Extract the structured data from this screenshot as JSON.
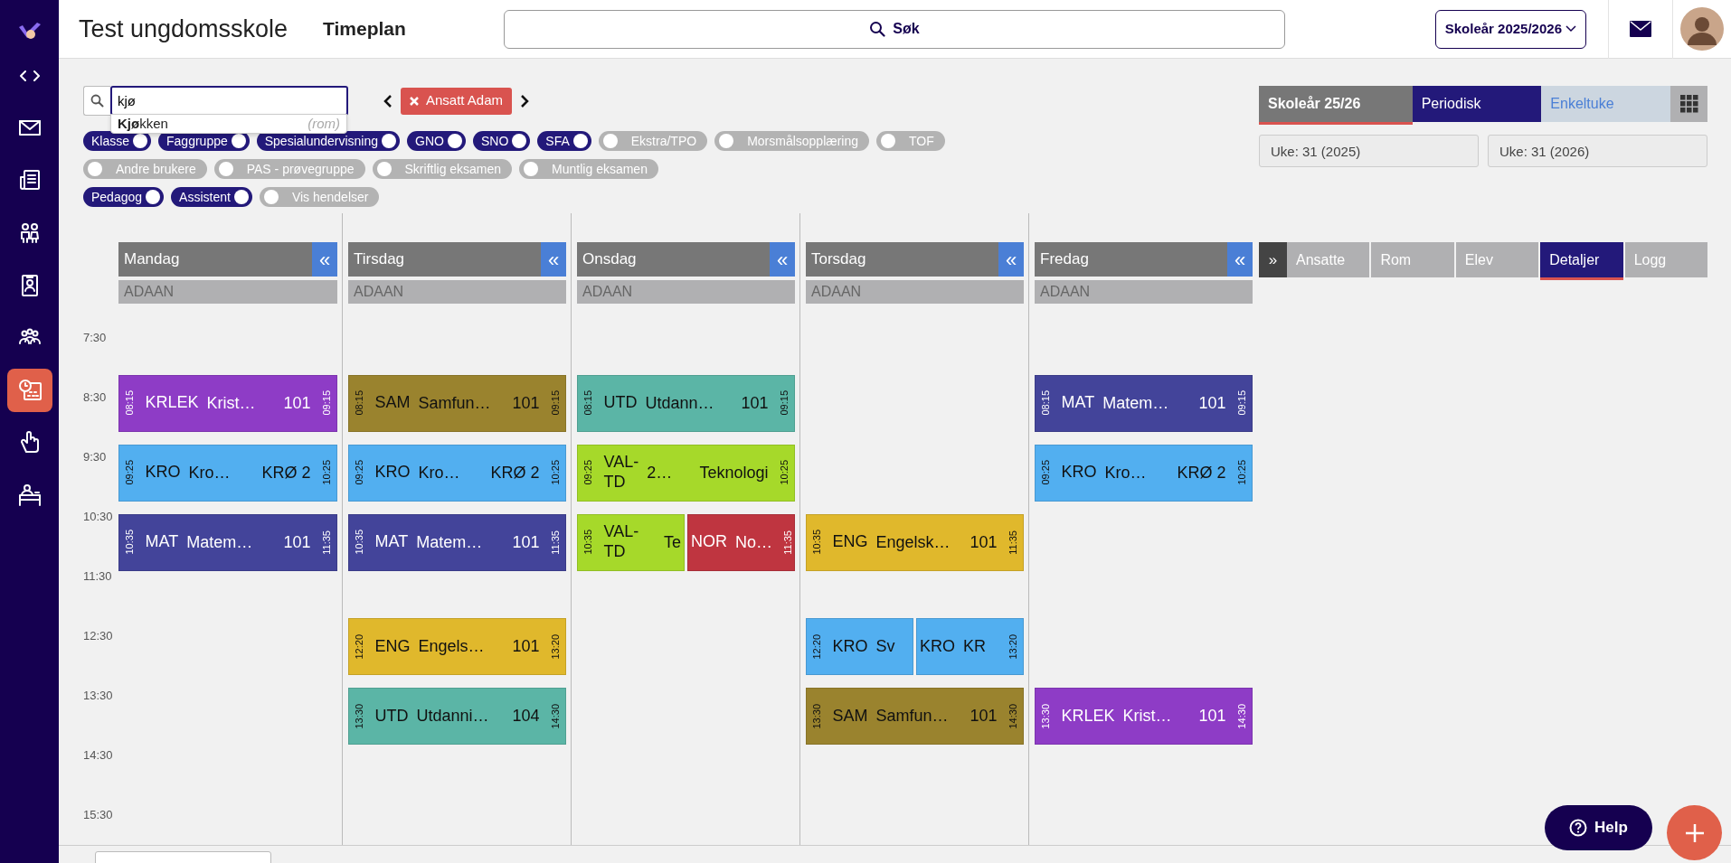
{
  "header": {
    "school": "Test ungdomsskole",
    "page": "Timeplan",
    "search": "Søk",
    "year_button": "Skoleår 2025/2026"
  },
  "sidebar": {
    "items": [
      {
        "selected": false
      },
      {
        "selected": false
      },
      {
        "selected": false
      },
      {
        "selected": false
      },
      {
        "selected": false
      },
      {
        "selected": false
      },
      {
        "selected": true
      },
      {
        "selected": false
      },
      {
        "selected": false
      }
    ]
  },
  "filter": {
    "search_value": "kjø",
    "suggestions": [
      {
        "text": "**Kjø**kken",
        "type": "(rom)"
      }
    ],
    "tag": "Ansatt Adam",
    "chip_rows": [
      [
        {
          "label": "Klasse",
          "on": true
        },
        {
          "label": "Faggruppe",
          "on": true
        },
        {
          "label": "Spesialundervisning",
          "on": true
        },
        {
          "label": "GNO",
          "on": true
        },
        {
          "label": "SNO",
          "on": true
        },
        {
          "label": "SFA",
          "on": true
        },
        {
          "label": "Ekstra/TPO",
          "on": false
        },
        {
          "label": "Morsmålsopplæring",
          "on": false
        },
        {
          "label": "TOF",
          "on": false
        }
      ],
      [
        {
          "label": "Andre brukere",
          "on": false
        },
        {
          "label": "PAS - prøvegruppe",
          "on": false
        },
        {
          "label": "Skriftlig eksamen",
          "on": false
        },
        {
          "label": "Muntlig eksamen",
          "on": false
        }
      ],
      [
        {
          "label": "Pedagog",
          "on": true
        },
        {
          "label": "Assistent",
          "on": true
        },
        {
          "label": "Vis hendelser",
          "on": false
        }
      ]
    ]
  },
  "schedule": {
    "times": [
      "7:30",
      "8:30",
      "9:30",
      "10:30",
      "11:30",
      "12:30",
      "13:30",
      "14:30",
      "15:30"
    ],
    "days": [
      {
        "name": "Mandag",
        "collapse": "«",
        "teacher": "ADAAN",
        "slots": [
          {
            "start": "08:15",
            "end": "09:15",
            "events": [
              {
                "code": "KRLEK",
                "name": "Krist…",
                "room": "101",
                "color": "#8e3cc6"
              }
            ]
          },
          {
            "start": "09:25",
            "end": "10:25",
            "events": [
              {
                "code": "KRO",
                "name": "Kro…",
                "room": "KRØ 2",
                "color": "#52aff0"
              }
            ]
          },
          {
            "start": "10:35",
            "end": "11:35",
            "events": [
              {
                "code": "MAT",
                "name": "Matem…",
                "room": "101",
                "color": "#43449a"
              }
            ]
          }
        ]
      },
      {
        "name": "Tirsdag",
        "collapse": "«",
        "teacher": "ADAAN",
        "slots": [
          {
            "start": "08:15",
            "end": "09:15",
            "events": [
              {
                "code": "SAM",
                "name": "Samfun…",
                "room": "101",
                "color": "#9a832e"
              }
            ]
          },
          {
            "start": "09:25",
            "end": "10:25",
            "events": [
              {
                "code": "KRO",
                "name": "Kro…",
                "room": "KRØ 2",
                "color": "#52aff0"
              }
            ]
          },
          {
            "start": "10:35",
            "end": "11:35",
            "events": [
              {
                "code": "MAT",
                "name": "Matem…",
                "room": "101",
                "color": "#43449a"
              }
            ]
          },
          {
            "start": "12:20",
            "end": "13:20",
            "events": [
              {
                "code": "ENG",
                "name": "Engels…",
                "room": "101",
                "color": "#e0b82c"
              }
            ]
          },
          {
            "start": "13:30",
            "end": "14:30",
            "events": [
              {
                "code": "UTD",
                "name": "Utdanni…",
                "room": "104",
                "color": "#5bb5a6"
              }
            ]
          }
        ]
      },
      {
        "name": "Onsdag",
        "collapse": "«",
        "teacher": "ADAAN",
        "slots": [
          {
            "start": "08:15",
            "end": "09:15",
            "events": [
              {
                "code": "UTD",
                "name": "Utdann…",
                "room": "101",
                "color": "#5bb5a6"
              }
            ]
          },
          {
            "start": "09:25",
            "end": "10:25",
            "events": [
              {
                "code": "VAL-TD",
                "name": "2…",
                "room": "Teknologi",
                "color": "#a6d92a"
              }
            ]
          },
          {
            "start": "10:35",
            "end": "11:35",
            "events": [
              {
                "code": "VAL-TD",
                "room": "Te",
                "color": "#a6d92a"
              },
              {
                "code": "NOR",
                "name": "No…",
                "color": "#bf3540"
              }
            ]
          }
        ]
      },
      {
        "name": "Torsdag",
        "collapse": "«",
        "teacher": "ADAAN",
        "slots": [
          {
            "start": "10:35",
            "end": "11:35",
            "events": [
              {
                "code": "ENG",
                "name": "Engelsk…",
                "room": "101",
                "color": "#e0b82c"
              }
            ]
          },
          {
            "start": "12:20",
            "end": "13:20",
            "events": [
              {
                "code": "KRO",
                "name": "Sv",
                "color": "#52aff0"
              },
              {
                "code": "KRO",
                "name": "KR",
                "color": "#52aff0"
              }
            ]
          },
          {
            "start": "13:30",
            "end": "14:30",
            "events": [
              {
                "code": "SAM",
                "name": "Samfun…",
                "room": "101",
                "color": "#9a832e"
              }
            ]
          }
        ]
      },
      {
        "name": "Fredag",
        "collapse": "«",
        "teacher": "ADAAN",
        "slots": [
          {
            "start": "08:15",
            "end": "09:15",
            "events": [
              {
                "code": "MAT",
                "name": "Matem…",
                "room": "101",
                "color": "#43449a"
              }
            ]
          },
          {
            "start": "09:25",
            "end": "10:25",
            "events": [
              {
                "code": "KRO",
                "name": "Kro…",
                "room": "KRØ 2",
                "color": "#52aff0"
              }
            ]
          },
          {
            "start": "13:30",
            "end": "14:30",
            "events": [
              {
                "code": "KRLEK",
                "name": "Krist…",
                "room": "101",
                "color": "#8e3cc6"
              }
            ]
          }
        ]
      }
    ]
  },
  "side_panel": {
    "period": {
      "label": "Skoleår 25/26",
      "selected": true
    },
    "modes": [
      {
        "label": "Periodisk",
        "selected": true
      },
      {
        "label": "Enkeltuke",
        "selected": false
      }
    ],
    "weeks": [
      "Uke: 31 (2025)",
      "Uke: 31 (2026)"
    ],
    "expand": "»",
    "detail_tabs": [
      {
        "label": "Ansatte",
        "selected": false
      },
      {
        "label": "Rom",
        "selected": false
      },
      {
        "label": "Elev",
        "selected": false
      },
      {
        "label": "Detaljer",
        "selected": true
      },
      {
        "label": "Logg",
        "selected": false
      }
    ]
  },
  "help": "Help"
}
